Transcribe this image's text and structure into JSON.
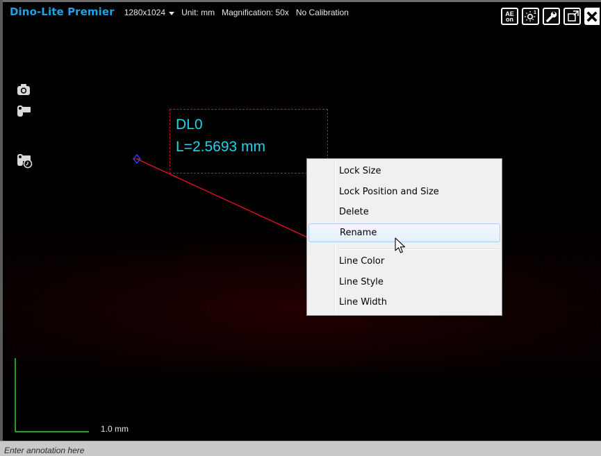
{
  "header": {
    "app_title": "Dino-Lite Premier",
    "resolution": "1280x1024",
    "unit": "Unit: mm",
    "magnification": "Magnification: 50x",
    "calibration": "No Calibration"
  },
  "toolbar": {
    "ae_label_top": "AE",
    "ae_label_bottom": "on",
    "items": [
      "auto-exposure-toggle",
      "led-brightness",
      "settings-wrench",
      "fullscreen",
      "close"
    ]
  },
  "measurement": {
    "name": "DL0",
    "length_text": "L=2.5693 mm",
    "line_color": "#e8121f",
    "label_color": "#22d3ec"
  },
  "context_menu": {
    "items": [
      {
        "label": "Lock Size",
        "highlighted": false
      },
      {
        "label": "Lock Position and Size",
        "highlighted": false
      },
      {
        "label": "Delete",
        "highlighted": false
      },
      {
        "label": "Rename",
        "highlighted": true
      },
      {
        "label": "Line Color",
        "highlighted": false
      },
      {
        "label": "Line Style",
        "highlighted": false
      },
      {
        "label": "Line Width",
        "highlighted": false
      }
    ]
  },
  "scale_bar": {
    "label": "1.0 mm",
    "color": "#3cd63c"
  },
  "annotation": {
    "placeholder": "Enter annotation here"
  },
  "colors": {
    "title": "#1fa3e8",
    "menu_highlight_border": "#aecff7"
  }
}
